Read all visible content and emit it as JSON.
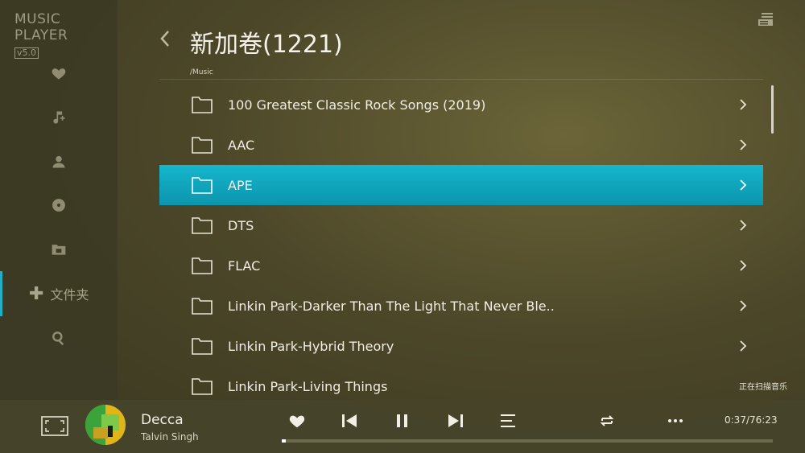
{
  "app": {
    "brand": "MUSIC PLAYER",
    "version": "v5.0"
  },
  "sidebar": {
    "items": [
      {
        "icon": "heart-icon"
      },
      {
        "icon": "music-note-icon"
      },
      {
        "icon": "user-icon"
      },
      {
        "icon": "disc-icon"
      },
      {
        "icon": "folder-icon"
      },
      {
        "icon": "plus-icon",
        "label": "文件夹",
        "active": true
      },
      {
        "icon": "search-icon"
      }
    ]
  },
  "header": {
    "title": "新加卷(1221)",
    "path": "/Music"
  },
  "list": {
    "items": [
      {
        "name": "100 Greatest Classic Rock Songs (2019)"
      },
      {
        "name": "AAC"
      },
      {
        "name": "APE",
        "selected": true
      },
      {
        "name": "DTS"
      },
      {
        "name": "FLAC"
      },
      {
        "name": "Linkin Park-Darker Than The Light That Never Ble.."
      },
      {
        "name": "Linkin Park-Hybrid Theory"
      },
      {
        "name": "Linkin Park-Living Things"
      }
    ]
  },
  "status": {
    "scan_text": "正在扫描音乐"
  },
  "player": {
    "song": "Decca",
    "artist": "Talvin Singh",
    "time": "0:37/76:23",
    "progress": 0.008
  },
  "colors": {
    "accent": "#1fb0c8",
    "selected_row": "#0fa8c0"
  }
}
